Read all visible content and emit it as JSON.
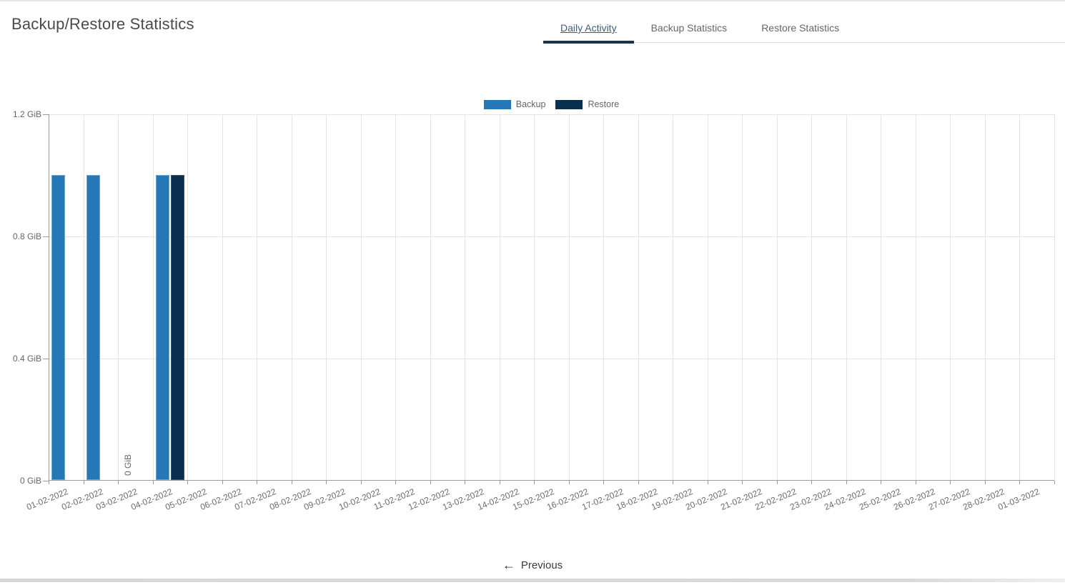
{
  "header": {
    "title": "Backup/Restore Statistics"
  },
  "tabs": [
    {
      "label": "Daily Activity",
      "active": true
    },
    {
      "label": "Backup Statistics",
      "active": false
    },
    {
      "label": "Restore Statistics",
      "active": false
    }
  ],
  "footer": {
    "previous_label": "Previous",
    "previous_icon": "arrow-left"
  },
  "colors": {
    "accent": "#16344f",
    "backup": "#2577b5",
    "backup_border": "#71a6cd",
    "restore": "#082f4e",
    "restore_border": "#3a566f",
    "grid": "#e4e4e4",
    "axis": "#9c9c9c"
  },
  "chart_data": {
    "type": "bar",
    "title": "",
    "xlabel": "",
    "ylabel": "",
    "ylim": [
      0,
      1.2
    ],
    "grid": true,
    "legend_position": "top",
    "categories": [
      "01-02-2022",
      "02-02-2022",
      "03-02-2022",
      "04-02-2022",
      "05-02-2022",
      "06-02-2022",
      "07-02-2022",
      "08-02-2022",
      "09-02-2022",
      "10-02-2022",
      "11-02-2022",
      "12-02-2022",
      "13-02-2022",
      "14-02-2022",
      "15-02-2022",
      "16-02-2022",
      "17-02-2022",
      "18-02-2022",
      "19-02-2022",
      "20-02-2022",
      "21-02-2022",
      "22-02-2022",
      "23-02-2022",
      "24-02-2022",
      "25-02-2022",
      "26-02-2022",
      "27-02-2022",
      "28-02-2022",
      "01-03-2022"
    ],
    "yticks": [
      {
        "value": 0,
        "label": "0 GiB"
      },
      {
        "value": 0.4,
        "label": "0.4 GiB"
      },
      {
        "value": 0.8,
        "label": "0.8 GiB"
      },
      {
        "value": 1.2,
        "label": "1.2 GiB"
      }
    ],
    "series": [
      {
        "name": "Backup",
        "color": "#2577b5",
        "border_color": "#71a6cd",
        "values": [
          1.0,
          1.0,
          0,
          1.0,
          0,
          0,
          0,
          0,
          0,
          0,
          0,
          0,
          0,
          0,
          0,
          0,
          0,
          0,
          0,
          0,
          0,
          0,
          0,
          0,
          0,
          0,
          0,
          0,
          0
        ]
      },
      {
        "name": "Restore",
        "color": "#082f4e",
        "border_color": "#3a566f",
        "values": [
          0,
          0,
          0,
          1.0,
          0,
          0,
          0,
          0,
          0,
          0,
          0,
          0,
          0,
          0,
          0,
          0,
          0,
          0,
          0,
          0,
          0,
          0,
          0,
          0,
          0,
          0,
          0,
          0,
          0
        ]
      }
    ],
    "annotations": [
      {
        "category_index": 2,
        "series": "Backup",
        "label": "0 GiB",
        "rotation": -90
      }
    ]
  }
}
